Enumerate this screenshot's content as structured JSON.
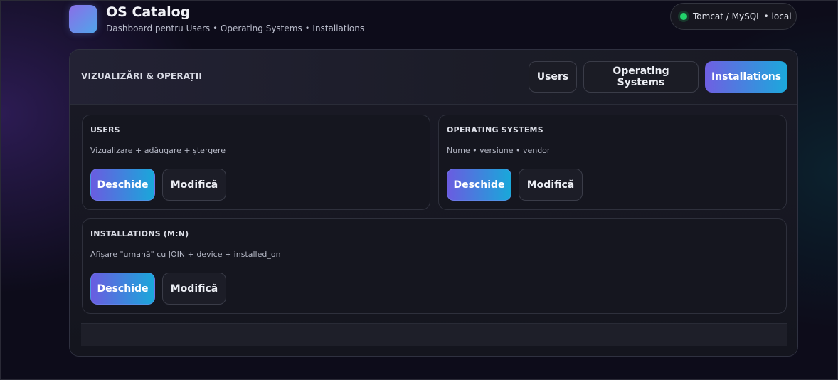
{
  "header": {
    "title": "OS Catalog",
    "subtitle": "Dashboard pentru Users • Operating Systems • Installations",
    "environment": "Tomcat / MySQL • local",
    "status_color": "#22d36b"
  },
  "panel": {
    "title": "VIZUALIZĂRI & OPERAȚII",
    "tabs": [
      {
        "label": "Users",
        "active": false
      },
      {
        "label": "Operating Systems",
        "active": false
      },
      {
        "label": "Installations",
        "active": true
      }
    ]
  },
  "cards": [
    {
      "title": "USERS",
      "description": "Vizualizare + adăugare + ștergere",
      "primary_label": "Deschide",
      "secondary_label": "Modifică"
    },
    {
      "title": "OPERATING SYSTEMS",
      "description": "Nume • versiune • vendor",
      "primary_label": "Deschide",
      "secondary_label": "Modifică"
    },
    {
      "title": "INSTALLATIONS (M:N)",
      "description": "Afișare \"umană\" cu JOIN + device + installed_on",
      "primary_label": "Deschide",
      "secondary_label": "Modifică"
    }
  ],
  "colors": {
    "accent_start": "#6a5ce0",
    "accent_end": "#19a8da",
    "background": "#0d0c1a"
  }
}
